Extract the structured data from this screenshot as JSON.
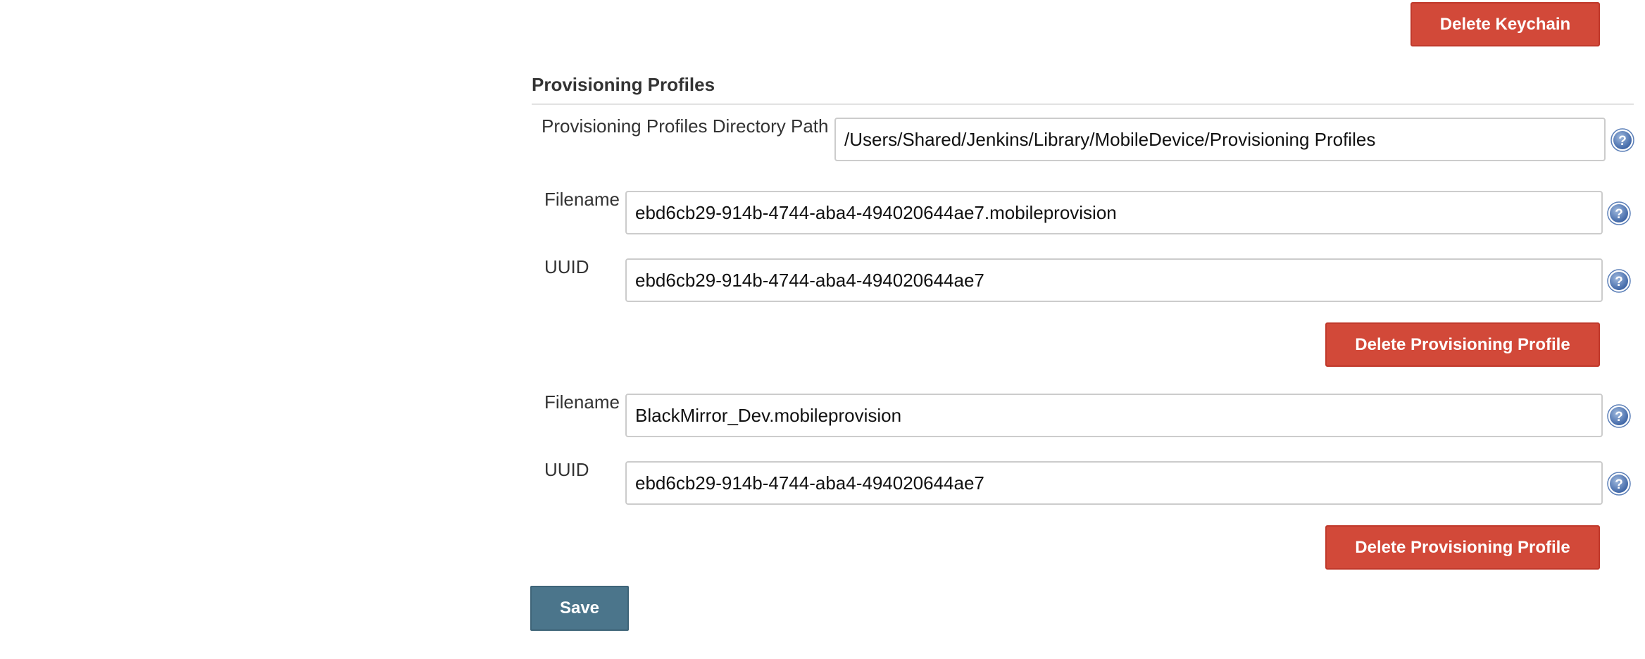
{
  "keychain": {
    "delete_label": "Delete Keychain"
  },
  "section": {
    "title": "Provisioning Profiles"
  },
  "directory": {
    "label": "Provisioning Profiles Directory Path",
    "value": "/Users/Shared/Jenkins/Library/MobileDevice/Provisioning Profiles"
  },
  "profiles": [
    {
      "filename_label": "Filename",
      "filename": "ebd6cb29-914b-4744-aba4-494020644ae7.mobileprovision",
      "uuid_label": "UUID",
      "uuid": "ebd6cb29-914b-4744-aba4-494020644ae7",
      "delete_label": "Delete Provisioning Profile"
    },
    {
      "filename_label": "Filename",
      "filename": "BlackMirror_Dev.mobileprovision",
      "uuid_label": "UUID",
      "uuid": "ebd6cb29-914b-4744-aba4-494020644ae7",
      "delete_label": "Delete Provisioning Profile"
    }
  ],
  "form": {
    "save_label": "Save"
  },
  "icons": {
    "help": "help-icon"
  },
  "colors": {
    "danger": "#d24939",
    "primary": "#4b758b",
    "help": "#5b7fb8"
  }
}
